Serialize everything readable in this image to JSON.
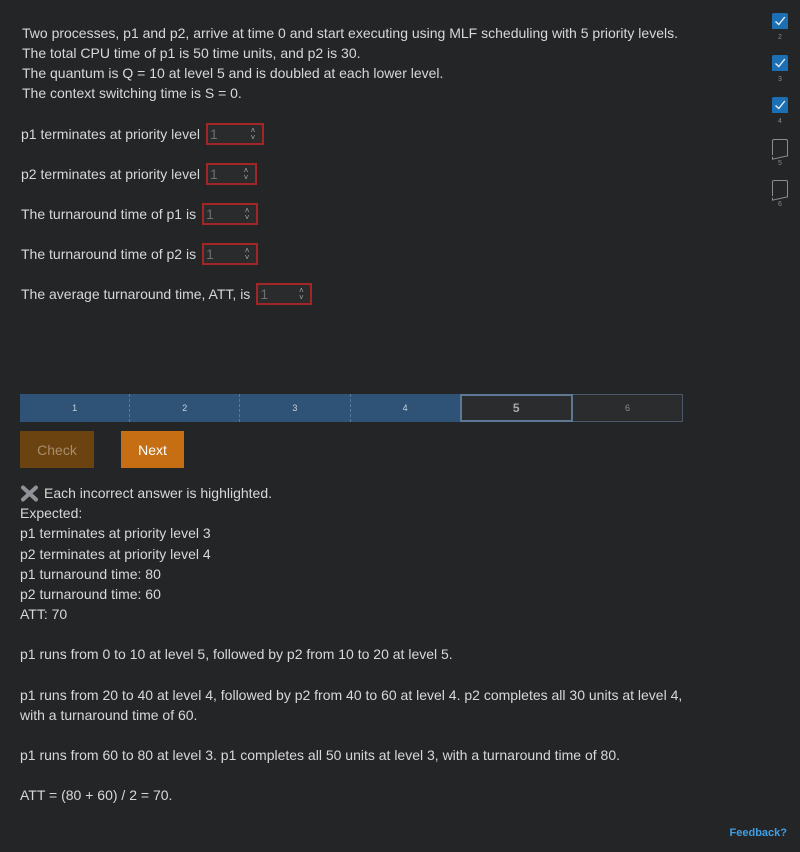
{
  "problem": {
    "lines": [
      "Two processes, p1 and p2, arrive at time 0 and start executing using MLF scheduling with 5 priority levels.",
      "The total CPU time of p1 is 50 time units, and p2 is 30.",
      "The quantum is Q = 10 at level 5 and is doubled at each lower level.",
      "The context switching time is S = 0."
    ]
  },
  "questions": [
    {
      "text": "p1 terminates at priority level",
      "value": "1"
    },
    {
      "text": "p2 terminates at priority level",
      "value": "1"
    },
    {
      "text": "The turnaround time of p1 is",
      "value": "1"
    },
    {
      "text": "The turnaround time of p2 is",
      "value": "1"
    },
    {
      "text": "The average turnaround time, ATT, is",
      "value": "1"
    }
  ],
  "progress": {
    "segments": [
      "1",
      "2",
      "3",
      "4",
      "5",
      "6"
    ],
    "current": 5
  },
  "buttons": {
    "check": "Check",
    "next": "Next"
  },
  "feedback": {
    "status": "Each incorrect answer is highlighted.",
    "expected_heading": "Expected:",
    "expected": [
      "p1 terminates at priority level 3",
      "p2 terminates at priority level 4",
      "p1 turnaround time: 80",
      "p2 turnaround time: 60",
      "ATT: 70"
    ],
    "explanations": [
      "p1 runs from 0 to 10 at level 5, followed by p2 from 10 to 20 at level 5.",
      "p1 runs from 20 to 40 at level 4, followed by p2 from 40 to 60 at level 4. p2 completes all 30 units at level 4, with a turnaround time of 60.",
      "p1 runs from 60 to 80 at level 3. p1 completes all 50 units at level 3, with a turnaround time of 80.",
      "ATT = (80 + 60) / 2 = 70."
    ]
  },
  "side_nav": {
    "items": [
      {
        "label": "2",
        "state": "checked"
      },
      {
        "label": "3",
        "state": "checked"
      },
      {
        "label": "4",
        "state": "checked"
      },
      {
        "label": "5",
        "state": "empty"
      },
      {
        "label": "6",
        "state": "empty"
      }
    ]
  },
  "feedback_link": "Feedback?",
  "colors": {
    "background": "#242527",
    "incorrect_border": "#a32626",
    "progress_done": "#2f5277",
    "check_button": "#6b4310",
    "next_button": "#c56e14",
    "link": "#3ea0e4",
    "checkmark_box": "#1d6fb4"
  },
  "icons": {
    "incorrect": "x-mark-icon",
    "spinner": "spinner-arrows-icon",
    "checked": "checkmark-icon"
  }
}
